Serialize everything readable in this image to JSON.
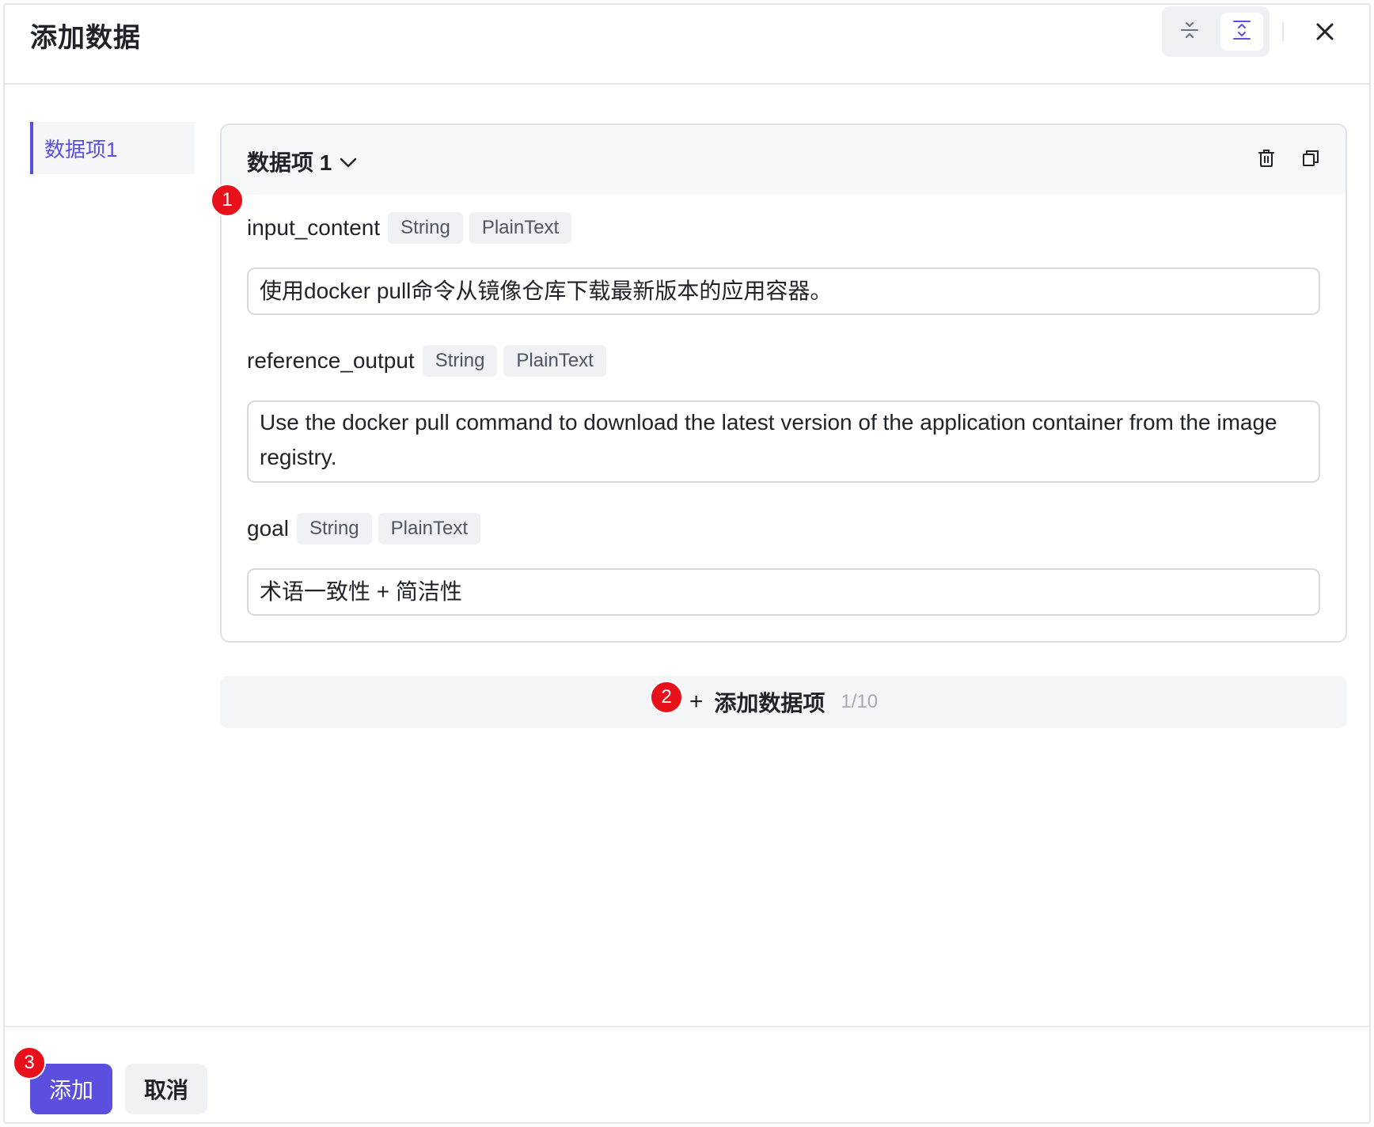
{
  "dialog": {
    "title": "添加数据",
    "icons": {
      "collapse": "collapse-all-icon",
      "expand": "expand-all-icon",
      "close": "close-icon"
    }
  },
  "sidebar": {
    "items": [
      {
        "label": "数据项1",
        "active": true
      }
    ]
  },
  "card": {
    "title": "数据项 1",
    "icons": {
      "chevron": "chevron-down-icon",
      "delete": "trash-icon",
      "copy": "copy-icon"
    },
    "fields": [
      {
        "name": "input_content",
        "type": "String",
        "format": "PlainText",
        "value": "使用docker pull命令从镜像仓库下载最新版本的应用容器。"
      },
      {
        "name": "reference_output",
        "type": "String",
        "format": "PlainText",
        "value": "Use the docker pull command to download the latest version of the application container from the image registry."
      },
      {
        "name": "goal",
        "type": "String",
        "format": "PlainText",
        "value": "术语一致性 + 简洁性"
      }
    ]
  },
  "add_item": {
    "plus": "+",
    "label": "添加数据项",
    "count": "1/10"
  },
  "footer": {
    "add_label": "添加",
    "cancel_label": "取消"
  },
  "markers": [
    "1",
    "2",
    "3"
  ],
  "colors": {
    "accent": "#5b4fe0",
    "marker": "#e8101a",
    "panel_bg": "#f6f7f9"
  }
}
